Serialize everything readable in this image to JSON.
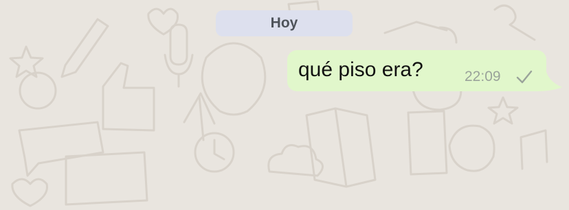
{
  "chat": {
    "date_separator": "Hoy",
    "messages": [
      {
        "direction": "outgoing",
        "text": "qué piso era?",
        "time": "22:09",
        "status_icon": "single-check-icon"
      }
    ]
  },
  "colors": {
    "background": "#e9e5df",
    "wallpaper_doodles": "#d8d2ca",
    "date_chip": "#dde0ee",
    "outgoing_bubble": "#e1f7cb",
    "time_text": "#9aa39a"
  }
}
